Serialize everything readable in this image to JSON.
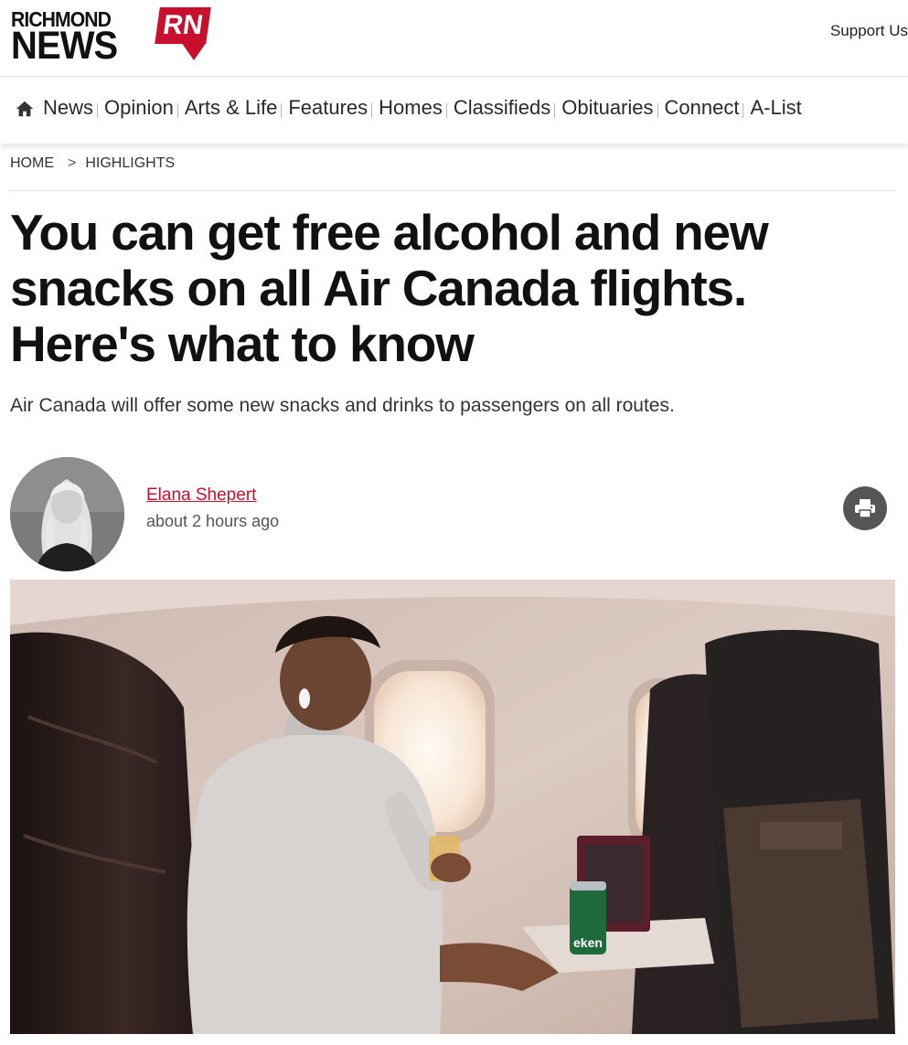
{
  "header": {
    "logo_top": "RICHMOND",
    "logo_bottom": "NEWS",
    "logo_badge": "RN",
    "support_label": "Support Us"
  },
  "nav": {
    "home_icon": "home-icon",
    "items": [
      "News",
      "Opinion",
      "Arts & Life",
      "Features",
      "Homes",
      "Classifieds",
      "Obituaries",
      "Connect",
      "A-List"
    ]
  },
  "breadcrumb": {
    "home": "HOME",
    "separator": ">",
    "section": "HIGHLIGHTS"
  },
  "article": {
    "headline": "You can get free alcohol and new snacks on all Air Canada flights. Here's what to know",
    "subhead": "Air Canada will offer some new snacks and drinks to passengers on all routes.",
    "author": "Elana Shepert",
    "time": "about 2 hours ago",
    "print_icon": "printer-icon",
    "can_label": "eken"
  },
  "colors": {
    "brand_red": "#c8102e",
    "text": "#222222",
    "print_button": "#555555"
  }
}
